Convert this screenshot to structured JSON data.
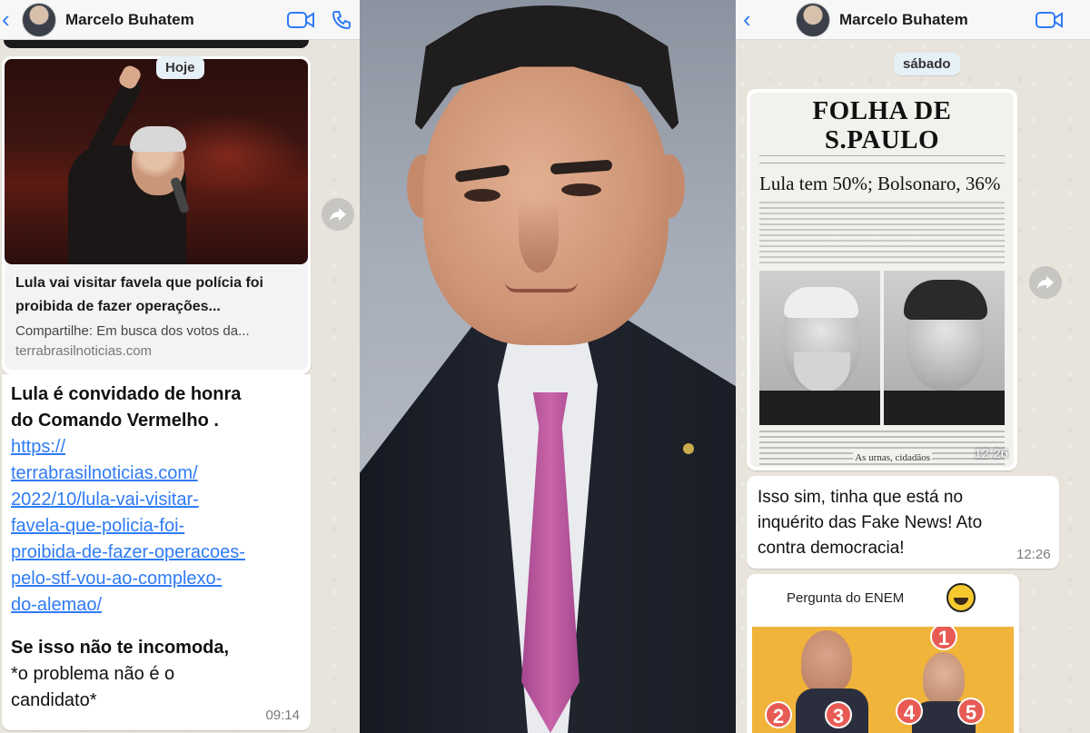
{
  "left_chat": {
    "contact_name": "Marcelo Buhatem",
    "day_chip": "Hoje",
    "link_preview": {
      "title": "Lula vai visitar favela que polícia foi proibida de fazer operações...",
      "description": "Compartilhe: Em busca dos votos da...",
      "domain": "terrabrasilnoticias.com"
    },
    "message": {
      "line1": "Lula é convidado de honra",
      "line2": "do Comando Vermelho .",
      "url_lines": [
        "https://",
        "terrabrasilnoticias.com/",
        "2022/10/lula-vai-visitar-",
        "favela-que-policia-foi-",
        "proibida-de-fazer-operacoes-",
        "pelo-stf-vou-ao-complexo-",
        "do-alemao/"
      ],
      "closing_line1": "Se isso não te incomoda,",
      "closing_line2": "*o problema não é o",
      "closing_line3": "candidato*",
      "time": "09:14"
    }
  },
  "right_chat": {
    "contact_name": "Marcelo Buhatem",
    "day_chip": "sábado",
    "newspaper": {
      "masthead": "FOLHA DE S.PAULO",
      "headline": "Lula tem 50%; Bolsonaro, 36%",
      "caption": "As urnas, cidadãos",
      "time": "12:26"
    },
    "message": {
      "line1": "Isso sim, tinha que está no",
      "line2": "inquérito das Fake News! Ato",
      "line3": "contra democracia!",
      "time": "12:26"
    },
    "enem_card": {
      "title": "Pergunta do ENEM",
      "badges": [
        "1",
        "2",
        "3",
        "4",
        "5"
      ]
    }
  },
  "colors": {
    "accent_blue": "#2f7bf5",
    "chat_background": "#e8e4dc",
    "tie_pink": "#c965a8"
  },
  "icons": [
    "back-icon",
    "video-call-icon",
    "phone-icon",
    "forward-icon",
    "laughing-emoji-icon"
  ]
}
